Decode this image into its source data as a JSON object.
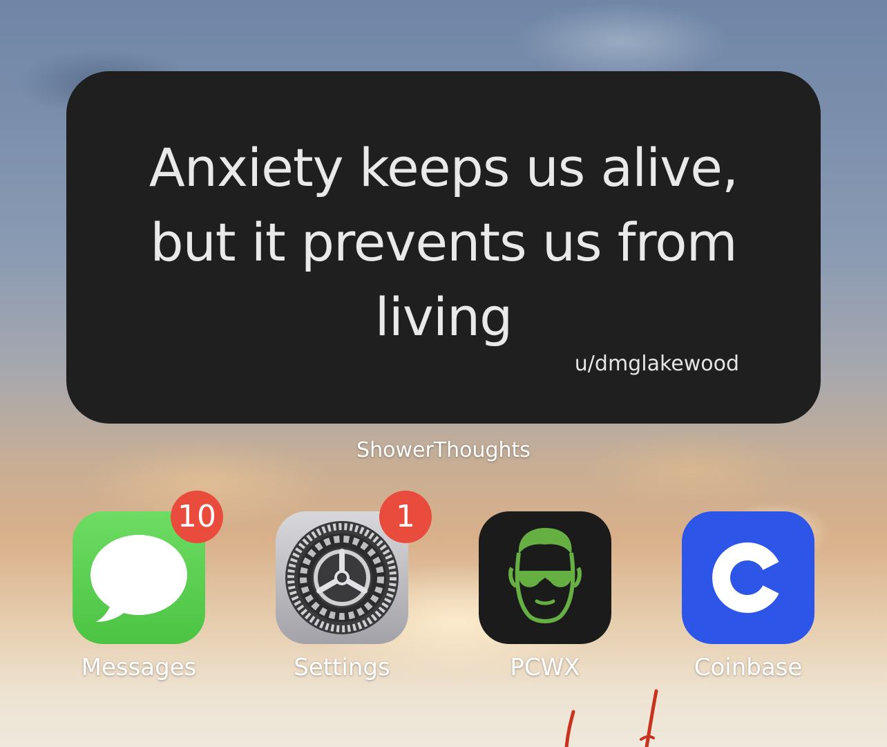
{
  "widget": {
    "quote": "Anxiety keeps us alive, but it prevents us from living",
    "author": "u/dmglakewood",
    "app_name": "ShowerThoughts",
    "background_color": "#1f1f1f"
  },
  "apps": [
    {
      "label": "Messages",
      "badge": "10",
      "icon": "messages-icon",
      "color": "#5fd35a"
    },
    {
      "label": "Settings",
      "badge": "1",
      "icon": "settings-gear-icon",
      "color": "#8e8e93"
    },
    {
      "label": "PCWX",
      "badge": "",
      "icon": "pcwx-face-icon",
      "color": "#1b1b1b"
    },
    {
      "label": "Coinbase",
      "badge": "",
      "icon": "coinbase-icon",
      "color": "#2d56e8"
    }
  ],
  "badge_color": "#e94b3c"
}
